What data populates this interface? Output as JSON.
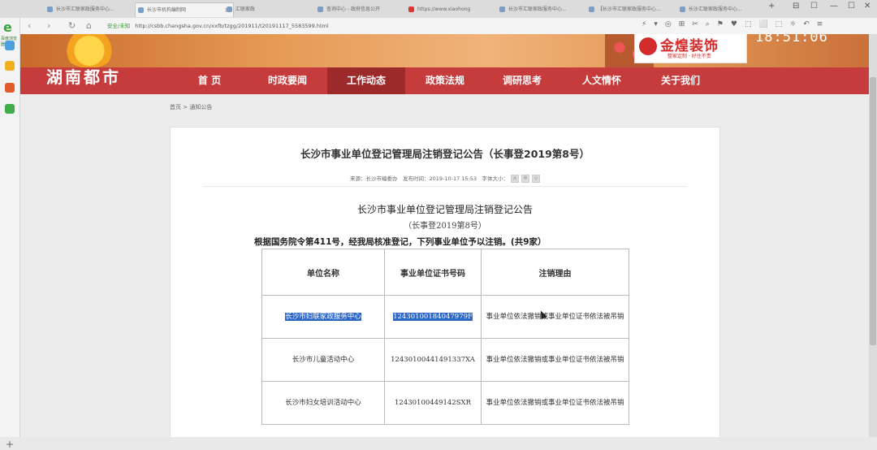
{
  "browser": {
    "tabs": [
      {
        "label": "长沙市汇联家政服务中心..."
      },
      {
        "label": "长沙市机构编制网"
      },
      {
        "label": "汇联家政"
      },
      {
        "label": "查询中心 - 政府信息公开"
      },
      {
        "label": "https://www.xiaohong"
      },
      {
        "label": "长沙市汇联家政服务中心..."
      },
      {
        "label": "【长沙市汇联家政服务中心..."
      },
      {
        "label": "长沙汇联家政服务中心..."
      }
    ],
    "address": {
      "security_label": "安全/未知",
      "url": "http://csbb.changsha.gov.cn/xxfb/tzgg/201911/t20191117_5583599.html"
    }
  },
  "sidebar": {
    "logo_text": "e",
    "logo_caption": "百度浏览器"
  },
  "site": {
    "name": "湖南都市",
    "clock": "18:51:06",
    "ad": {
      "brand": "金煌装饰",
      "slogan": "整家定制 · 好住不贵"
    },
    "menu": [
      {
        "label": "首 页",
        "active": false
      },
      {
        "label": "时政要闻",
        "active": false
      },
      {
        "label": "工作动态",
        "active": true
      },
      {
        "label": "政策法规",
        "active": false
      },
      {
        "label": "调研思考",
        "active": false
      },
      {
        "label": "人文情怀",
        "active": false
      },
      {
        "label": "关于我们",
        "active": false
      }
    ],
    "breadcrumb": "首页 > 通知公告"
  },
  "article": {
    "title": "长沙市事业单位登记管理局注销登记公告（长事登2019第8号）",
    "meta": "来源：长沙市编委办　发布时间：2019-10-17 15:53　字体大小：",
    "font_sizes": [
      "大",
      "中",
      "小"
    ],
    "heading": "长沙市事业单位登记管理局注销登记公告",
    "subheading": "（长事登2019第8号）",
    "intro": "根据国务院令第411号，经我局核准登记，下列事业单位予以注销。(共9家）",
    "table": {
      "headers": [
        "单位名称",
        "事业单位证书号码",
        "注销理由"
      ],
      "rows": [
        [
          "长沙市妇联家政服务中心",
          "12430100184047979F",
          "事业单位依法撤销或事业单位证书依法被吊销"
        ],
        [
          "长沙市儿童活动中心",
          "12430100441491337XA",
          "事业单位依法撤销或事业单位证书依法被吊销"
        ],
        [
          "长沙市妇女培训活动中心",
          "12430100449142SXR",
          "事业单位依法撤销或事业单位证书依法被吊销"
        ]
      ]
    }
  }
}
